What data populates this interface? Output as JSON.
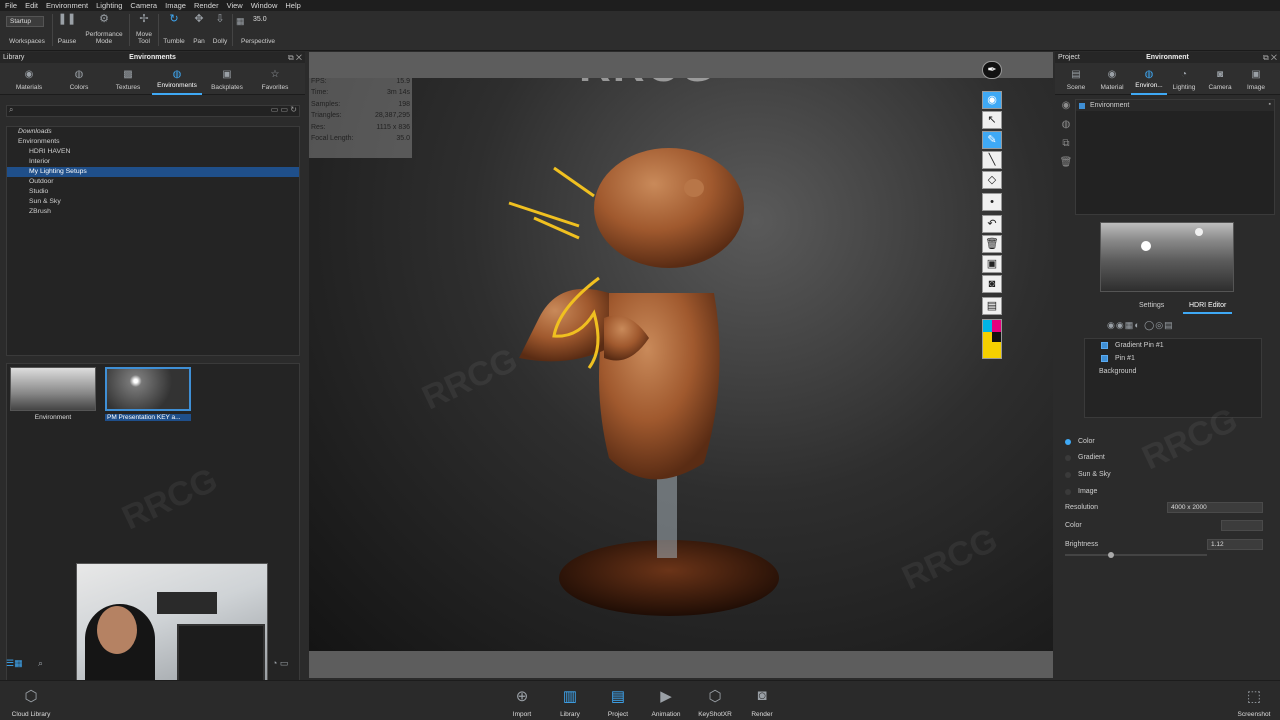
{
  "menu": [
    "File",
    "Edit",
    "Environment",
    "Lighting",
    "Camera",
    "Image",
    "Render",
    "View",
    "Window",
    "Help"
  ],
  "toolbar": {
    "workspace_select": "Startup",
    "workspaces": "Workspaces",
    "pause": "Pause",
    "performance": "Performance Mode",
    "move_tool": "Move Tool",
    "tumble": "Tumble",
    "pan": "Pan",
    "dolly": "Dolly",
    "fov_value": "35.0",
    "perspective": "Perspective"
  },
  "watermark": "RRCG",
  "library": {
    "panel_label": "Library",
    "panel_title": "Environments",
    "tabs": [
      "Materials",
      "Colors",
      "Textures",
      "Environments",
      "Backplates",
      "Favorites"
    ],
    "tree": [
      "Downloads",
      "Environments",
      "HDRI HAVEN",
      "Interior",
      "My Lighting Setups",
      "Outdoor",
      "Studio",
      "Sun & Sky",
      "ZBrush"
    ],
    "thumbs": [
      "Environment",
      "PM Presentation KEY a..."
    ]
  },
  "viewport": {
    "stats": [
      {
        "k": "FPS:",
        "v": "15.9"
      },
      {
        "k": "Time:",
        "v": "3m 14s"
      },
      {
        "k": "Samples:",
        "v": "198"
      },
      {
        "k": "Triangles:",
        "v": "28,387,295"
      },
      {
        "k": "Res:",
        "v": "1115 x 836"
      },
      {
        "k": "Focal Length:",
        "v": "35.0"
      }
    ]
  },
  "project": {
    "panel_label": "Project",
    "panel_title": "Environment",
    "tabs": [
      "Scene",
      "Material",
      "Environ...",
      "Lighting",
      "Camera",
      "Image"
    ],
    "env_item": "Environment",
    "subtabs": [
      "Settings",
      "HDRI Editor"
    ],
    "pins": [
      "Gradient Pin #1",
      "Pin #1",
      "Background"
    ],
    "bg_options": [
      "Color",
      "Gradient",
      "Sun & Sky",
      "Image"
    ],
    "resolution_label": "Resolution",
    "resolution_value": "4000 x 2000",
    "color_label": "Color",
    "brightness_label": "Brightness",
    "brightness_value": "1.12",
    "brightness_level": 0.3
  },
  "bottom": {
    "cloud_library": "Cloud Library",
    "buttons": [
      "Import",
      "Library",
      "Project",
      "Animation",
      "KeyShotXR",
      "Render"
    ],
    "screenshot": "Screenshot"
  },
  "colors": {
    "accent": "#3fa9f5",
    "selection": "#1f4f8a",
    "clay": "#a8643a"
  }
}
